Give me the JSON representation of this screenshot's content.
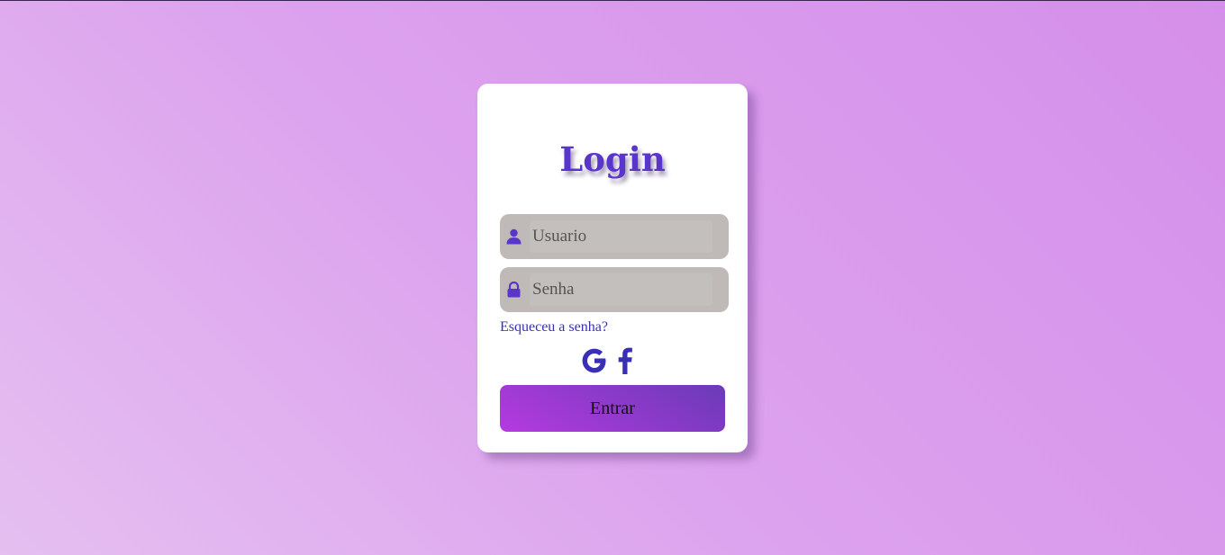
{
  "login": {
    "title": "Login",
    "username": {
      "placeholder": "Usuario",
      "value": ""
    },
    "password": {
      "placeholder": "Senha",
      "value": ""
    },
    "forgot_link": "Esqueceu a senha?",
    "social": [
      {
        "icon": "google-icon"
      },
      {
        "icon": "facebook-icon"
      }
    ],
    "submit_label": "Entrar"
  },
  "colors": {
    "accent": "#5a35cc",
    "link": "#3a2fb8",
    "icon": "#3a2fb8",
    "field_bg": "#bfbab8",
    "button_gradient": [
      "#b53ae0",
      "#6a3bb8"
    ]
  }
}
